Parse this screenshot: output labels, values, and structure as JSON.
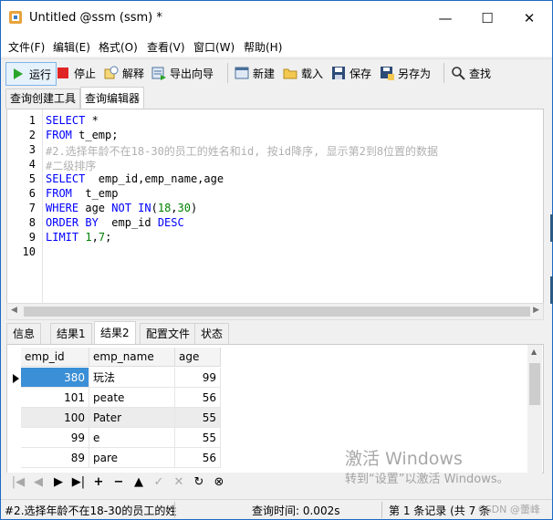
{
  "window": {
    "title": "Untitled @ssm (ssm) *",
    "controls": {
      "minimize": "—",
      "maximize": "☐",
      "close": "✕"
    }
  },
  "menu": [
    "文件(F)",
    "编辑(E)",
    "格式(O)",
    "查看(V)",
    "窗口(W)",
    "帮助(H)"
  ],
  "toolbar": {
    "run": "运行",
    "stop": "停止",
    "explain": "解释",
    "export_wizard": "导出向导",
    "new": "新建",
    "load": "载入",
    "save": "保存",
    "save_as": "另存为",
    "find": "查找"
  },
  "top_tabs": [
    "查询创建工具",
    "查询编辑器"
  ],
  "editor": {
    "line_numbers": [
      "1",
      "2",
      "3",
      "4",
      "5",
      "6",
      "7",
      "8",
      "9",
      "10"
    ],
    "l1": {
      "kw": "SELECT",
      "rest": " *"
    },
    "l2": {
      "kw": "FROM",
      "rest": " t_emp;"
    },
    "l3": "#2.选择年龄不在18-30的员工的姓名和id, 按id降序, 显示第2到8位置的数据",
    "l4": "#二级排序",
    "l5": {
      "kw": "SELECT",
      "rest": "  emp_id,emp_name,age"
    },
    "l6": {
      "kw": "FROM",
      "rest": "  t_emp"
    },
    "l7": {
      "kw1": "WHERE",
      "mid1": " age ",
      "kw2": "NOT IN",
      "mid2": "(",
      "n1": "18",
      "mid3": ",",
      "n2": "30",
      "end": ")"
    },
    "l8": {
      "kw1": "ORDER BY",
      "mid": "  emp_id ",
      "kw2": "DESC"
    },
    "l9": {
      "kw": "LIMIT",
      "sp": " ",
      "n1": "1",
      "mid": ",",
      "n2": "7",
      "end": ";"
    }
  },
  "result_tabs": [
    "信息",
    "结果1",
    "结果2",
    "配置文件",
    "状态"
  ],
  "result_table": {
    "columns": [
      "emp_id",
      "emp_name",
      "age"
    ],
    "rows": [
      [
        "380",
        "玩法",
        "99"
      ],
      [
        "101",
        "peate",
        "56"
      ],
      [
        "100",
        "Pater",
        "55"
      ],
      [
        "99",
        "e",
        "55"
      ],
      [
        "89",
        "pare",
        "56"
      ]
    ]
  },
  "navbar": {
    "first": "|◀",
    "prev": "◀",
    "next": "▶",
    "last": "▶|",
    "add": "+",
    "delete": "−",
    "up": "▲",
    "check": "✓",
    "cancel": "✕",
    "refresh": "↻",
    "stop": "⊗"
  },
  "status": {
    "query_text": "#2.选择年龄不在18-30的员工的姓",
    "query_time": "查询时间: 0.002s",
    "records": "第 1 条记录 (共 7 条"
  },
  "watermark": {
    "line1": "激活 Windows",
    "line2": "转到“设置”以激活 Windows。",
    "csdn": "CSDN @蕾峰"
  }
}
